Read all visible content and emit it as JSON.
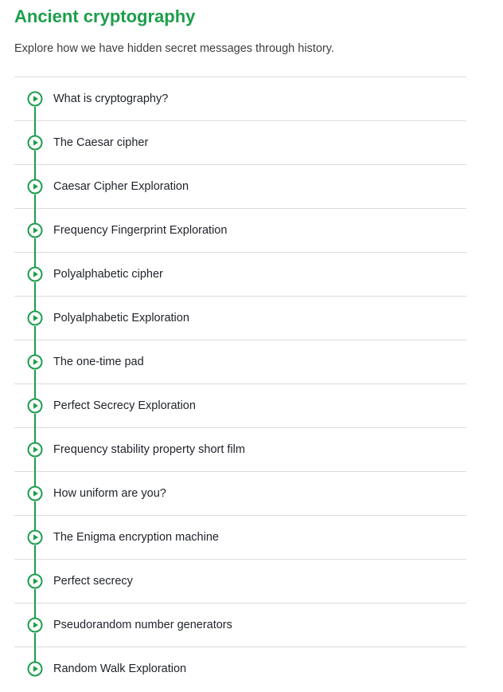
{
  "page": {
    "title": "Ancient cryptography",
    "description": "Explore how we have hidden secret messages through history."
  },
  "colors": {
    "accent": "#1c9e4b",
    "text": "#21242c",
    "divider": "#dcdcdc"
  },
  "lessons": [
    {
      "title": "What is cryptography?",
      "icon": "play-circle-icon"
    },
    {
      "title": "The Caesar cipher",
      "icon": "play-circle-icon"
    },
    {
      "title": "Caesar Cipher Exploration",
      "icon": "play-circle-icon"
    },
    {
      "title": "Frequency Fingerprint Exploration",
      "icon": "play-circle-icon"
    },
    {
      "title": "Polyalphabetic cipher",
      "icon": "play-circle-icon"
    },
    {
      "title": "Polyalphabetic Exploration",
      "icon": "play-circle-icon"
    },
    {
      "title": "The one-time pad",
      "icon": "play-circle-icon"
    },
    {
      "title": "Perfect Secrecy Exploration",
      "icon": "play-circle-icon"
    },
    {
      "title": "Frequency stability property short film",
      "icon": "play-circle-icon"
    },
    {
      "title": "How uniform are you?",
      "icon": "play-circle-icon"
    },
    {
      "title": "The Enigma encryption machine",
      "icon": "play-circle-icon"
    },
    {
      "title": "Perfect secrecy",
      "icon": "play-circle-icon"
    },
    {
      "title": "Pseudorandom number generators",
      "icon": "play-circle-icon"
    },
    {
      "title": "Random Walk Exploration",
      "icon": "play-circle-icon"
    }
  ]
}
